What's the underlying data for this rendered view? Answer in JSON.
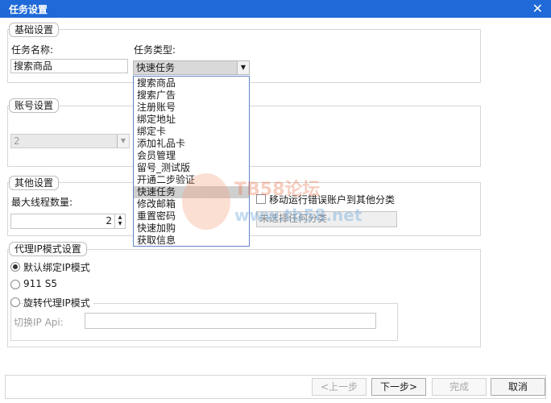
{
  "window": {
    "title": "任务设置",
    "close_glyph": "✕"
  },
  "basic": {
    "legend": "基础设置",
    "task_name_label": "任务名称:",
    "task_name_value": "搜索商品",
    "task_type_label": "任务类型:",
    "task_type_selected": "快速任务",
    "task_type_options": [
      "搜索商品",
      "搜索广告",
      "注册账号",
      "绑定地址",
      "绑定卡",
      "添加礼品卡",
      "会员管理",
      "留号_测试版",
      "开通二步验证",
      "快速任务",
      "修改邮箱",
      "重置密码",
      "快速加购",
      "获取信息"
    ],
    "task_type_selected_index": 9
  },
  "account": {
    "legend": "账号设置",
    "combo_value": "2"
  },
  "other": {
    "legend": "其他设置",
    "max_threads_label": "最大线程数量:",
    "max_threads_value": "2",
    "move_error_label": "移动运行错误账户到其他分类",
    "category_placeholder": "未选择任何分类"
  },
  "proxy": {
    "legend": "代理IP模式设置",
    "mode_default": "默认绑定IP模式",
    "mode_911": "911 S5",
    "mode_rotate": "旋转代理IP模式",
    "switch_api_label": "切换IP Api:",
    "switch_api_value": ""
  },
  "watermark": {
    "line1": "TB58论坛",
    "line2": "www.tb58.net"
  },
  "footer": {
    "prev": "<上一步",
    "next": "下一步>",
    "finish": "完成",
    "cancel": "取消"
  },
  "colors": {
    "titlebar": "#1f69d8",
    "dropdown_border": "#5f86c7",
    "selected_item": "#cfcfcf"
  }
}
